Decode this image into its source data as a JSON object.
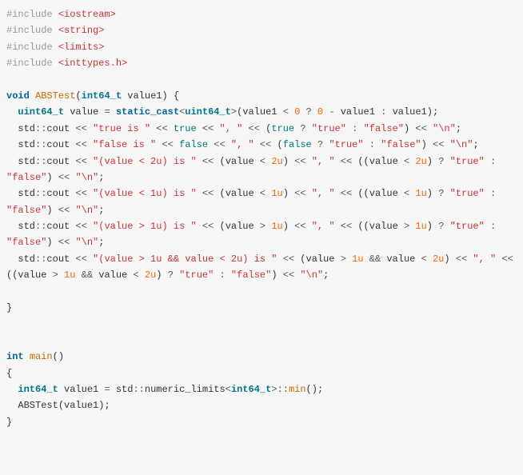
{
  "tokens": [
    {
      "cls": "pp",
      "t": "#include "
    },
    {
      "cls": "str",
      "t": "<iostream>"
    },
    {
      "cls": "",
      "t": "\n"
    },
    {
      "cls": "pp",
      "t": "#include "
    },
    {
      "cls": "str",
      "t": "<string>"
    },
    {
      "cls": "",
      "t": "\n"
    },
    {
      "cls": "pp",
      "t": "#include "
    },
    {
      "cls": "str",
      "t": "<limits>"
    },
    {
      "cls": "",
      "t": "\n"
    },
    {
      "cls": "pp",
      "t": "#include "
    },
    {
      "cls": "str",
      "t": "<inttypes.h>"
    },
    {
      "cls": "",
      "t": "\n"
    },
    {
      "cls": "",
      "t": "\n"
    },
    {
      "cls": "typ",
      "t": "void"
    },
    {
      "cls": "",
      "t": " "
    },
    {
      "cls": "fn",
      "t": "ABSTest"
    },
    {
      "cls": "pn",
      "t": "("
    },
    {
      "cls": "utyp",
      "t": "int64_t"
    },
    {
      "cls": "",
      "t": " "
    },
    {
      "cls": "id",
      "t": "value1"
    },
    {
      "cls": "pn",
      "t": ")"
    },
    {
      "cls": "",
      "t": " "
    },
    {
      "cls": "pn",
      "t": "{"
    },
    {
      "cls": "",
      "t": "\n"
    },
    {
      "cls": "",
      "t": "  "
    },
    {
      "cls": "utyp",
      "t": "uint64_t"
    },
    {
      "cls": "",
      "t": " "
    },
    {
      "cls": "id",
      "t": "value"
    },
    {
      "cls": "",
      "t": " "
    },
    {
      "cls": "op",
      "t": "="
    },
    {
      "cls": "",
      "t": " "
    },
    {
      "cls": "kw",
      "t": "static_cast"
    },
    {
      "cls": "op",
      "t": "<"
    },
    {
      "cls": "utyp",
      "t": "uint64_t"
    },
    {
      "cls": "op",
      "t": ">"
    },
    {
      "cls": "pn",
      "t": "("
    },
    {
      "cls": "id",
      "t": "value1"
    },
    {
      "cls": "",
      "t": " "
    },
    {
      "cls": "op",
      "t": "<"
    },
    {
      "cls": "",
      "t": " "
    },
    {
      "cls": "num",
      "t": "0"
    },
    {
      "cls": "",
      "t": " "
    },
    {
      "cls": "op",
      "t": "?"
    },
    {
      "cls": "",
      "t": " "
    },
    {
      "cls": "num",
      "t": "0"
    },
    {
      "cls": "",
      "t": " "
    },
    {
      "cls": "op",
      "t": "-"
    },
    {
      "cls": "",
      "t": " "
    },
    {
      "cls": "id",
      "t": "value1"
    },
    {
      "cls": "",
      "t": " "
    },
    {
      "cls": "op",
      "t": ":"
    },
    {
      "cls": "",
      "t": " "
    },
    {
      "cls": "id",
      "t": "value1"
    },
    {
      "cls": "pn",
      "t": ")"
    },
    {
      "cls": "pn",
      "t": ";"
    },
    {
      "cls": "",
      "t": "\n"
    },
    {
      "cls": "",
      "t": "  "
    },
    {
      "cls": "id",
      "t": "std"
    },
    {
      "cls": "op",
      "t": "::"
    },
    {
      "cls": "id",
      "t": "cout"
    },
    {
      "cls": "",
      "t": " "
    },
    {
      "cls": "op",
      "t": "<<"
    },
    {
      "cls": "",
      "t": " "
    },
    {
      "cls": "str",
      "t": "\"true is \""
    },
    {
      "cls": "",
      "t": " "
    },
    {
      "cls": "op",
      "t": "<<"
    },
    {
      "cls": "",
      "t": " "
    },
    {
      "cls": "bool",
      "t": "true"
    },
    {
      "cls": "",
      "t": " "
    },
    {
      "cls": "op",
      "t": "<<"
    },
    {
      "cls": "",
      "t": " "
    },
    {
      "cls": "str",
      "t": "\", \""
    },
    {
      "cls": "",
      "t": " "
    },
    {
      "cls": "op",
      "t": "<<"
    },
    {
      "cls": "",
      "t": " "
    },
    {
      "cls": "pn",
      "t": "("
    },
    {
      "cls": "bool",
      "t": "true"
    },
    {
      "cls": "",
      "t": " "
    },
    {
      "cls": "op",
      "t": "?"
    },
    {
      "cls": "",
      "t": " "
    },
    {
      "cls": "str",
      "t": "\"true\""
    },
    {
      "cls": "",
      "t": " "
    },
    {
      "cls": "op",
      "t": ":"
    },
    {
      "cls": "",
      "t": " "
    },
    {
      "cls": "str",
      "t": "\"false\""
    },
    {
      "cls": "pn",
      "t": ")"
    },
    {
      "cls": "",
      "t": " "
    },
    {
      "cls": "op",
      "t": "<<"
    },
    {
      "cls": "",
      "t": " "
    },
    {
      "cls": "str",
      "t": "\"\\n\""
    },
    {
      "cls": "pn",
      "t": ";"
    },
    {
      "cls": "",
      "t": "\n"
    },
    {
      "cls": "",
      "t": "  "
    },
    {
      "cls": "id",
      "t": "std"
    },
    {
      "cls": "op",
      "t": "::"
    },
    {
      "cls": "id",
      "t": "cout"
    },
    {
      "cls": "",
      "t": " "
    },
    {
      "cls": "op",
      "t": "<<"
    },
    {
      "cls": "",
      "t": " "
    },
    {
      "cls": "str",
      "t": "\"false is \""
    },
    {
      "cls": "",
      "t": " "
    },
    {
      "cls": "op",
      "t": "<<"
    },
    {
      "cls": "",
      "t": " "
    },
    {
      "cls": "bool",
      "t": "false"
    },
    {
      "cls": "",
      "t": " "
    },
    {
      "cls": "op",
      "t": "<<"
    },
    {
      "cls": "",
      "t": " "
    },
    {
      "cls": "str",
      "t": "\", \""
    },
    {
      "cls": "",
      "t": " "
    },
    {
      "cls": "op",
      "t": "<<"
    },
    {
      "cls": "",
      "t": " "
    },
    {
      "cls": "pn",
      "t": "("
    },
    {
      "cls": "bool",
      "t": "false"
    },
    {
      "cls": "",
      "t": " "
    },
    {
      "cls": "op",
      "t": "?"
    },
    {
      "cls": "",
      "t": " "
    },
    {
      "cls": "str",
      "t": "\"true\""
    },
    {
      "cls": "",
      "t": " "
    },
    {
      "cls": "op",
      "t": ":"
    },
    {
      "cls": "",
      "t": " "
    },
    {
      "cls": "str",
      "t": "\"false\""
    },
    {
      "cls": "pn",
      "t": ")"
    },
    {
      "cls": "",
      "t": " "
    },
    {
      "cls": "op",
      "t": "<<"
    },
    {
      "cls": "",
      "t": " "
    },
    {
      "cls": "str",
      "t": "\"\\n\""
    },
    {
      "cls": "pn",
      "t": ";"
    },
    {
      "cls": "",
      "t": "\n"
    },
    {
      "cls": "",
      "t": "  "
    },
    {
      "cls": "id",
      "t": "std"
    },
    {
      "cls": "op",
      "t": "::"
    },
    {
      "cls": "id",
      "t": "cout"
    },
    {
      "cls": "",
      "t": " "
    },
    {
      "cls": "op",
      "t": "<<"
    },
    {
      "cls": "",
      "t": " "
    },
    {
      "cls": "str",
      "t": "\"(value < 2u) is \""
    },
    {
      "cls": "",
      "t": " "
    },
    {
      "cls": "op",
      "t": "<<"
    },
    {
      "cls": "",
      "t": " "
    },
    {
      "cls": "pn",
      "t": "("
    },
    {
      "cls": "id",
      "t": "value"
    },
    {
      "cls": "",
      "t": " "
    },
    {
      "cls": "op",
      "t": "<"
    },
    {
      "cls": "",
      "t": " "
    },
    {
      "cls": "num",
      "t": "2u"
    },
    {
      "cls": "pn",
      "t": ")"
    },
    {
      "cls": "",
      "t": " "
    },
    {
      "cls": "op",
      "t": "<<"
    },
    {
      "cls": "",
      "t": " "
    },
    {
      "cls": "str",
      "t": "\", \""
    },
    {
      "cls": "",
      "t": " "
    },
    {
      "cls": "op",
      "t": "<<"
    },
    {
      "cls": "",
      "t": " "
    },
    {
      "cls": "pn",
      "t": "(("
    },
    {
      "cls": "id",
      "t": "value"
    },
    {
      "cls": "",
      "t": " "
    },
    {
      "cls": "op",
      "t": "<"
    },
    {
      "cls": "",
      "t": " "
    },
    {
      "cls": "num",
      "t": "2u"
    },
    {
      "cls": "pn",
      "t": ")"
    },
    {
      "cls": "",
      "t": " "
    },
    {
      "cls": "op",
      "t": "?"
    },
    {
      "cls": "",
      "t": " "
    },
    {
      "cls": "str",
      "t": "\"true\""
    },
    {
      "cls": "",
      "t": " "
    },
    {
      "cls": "op",
      "t": ":"
    },
    {
      "cls": "",
      "t": " "
    },
    {
      "cls": "str",
      "t": "\"false\""
    },
    {
      "cls": "pn",
      "t": ")"
    },
    {
      "cls": "",
      "t": " "
    },
    {
      "cls": "op",
      "t": "<<"
    },
    {
      "cls": "",
      "t": " "
    },
    {
      "cls": "str",
      "t": "\"\\n\""
    },
    {
      "cls": "pn",
      "t": ";"
    },
    {
      "cls": "",
      "t": "\n"
    },
    {
      "cls": "",
      "t": "  "
    },
    {
      "cls": "id",
      "t": "std"
    },
    {
      "cls": "op",
      "t": "::"
    },
    {
      "cls": "id",
      "t": "cout"
    },
    {
      "cls": "",
      "t": " "
    },
    {
      "cls": "op",
      "t": "<<"
    },
    {
      "cls": "",
      "t": " "
    },
    {
      "cls": "str",
      "t": "\"(value < 1u) is \""
    },
    {
      "cls": "",
      "t": " "
    },
    {
      "cls": "op",
      "t": "<<"
    },
    {
      "cls": "",
      "t": " "
    },
    {
      "cls": "pn",
      "t": "("
    },
    {
      "cls": "id",
      "t": "value"
    },
    {
      "cls": "",
      "t": " "
    },
    {
      "cls": "op",
      "t": "<"
    },
    {
      "cls": "",
      "t": " "
    },
    {
      "cls": "num",
      "t": "1u"
    },
    {
      "cls": "pn",
      "t": ")"
    },
    {
      "cls": "",
      "t": " "
    },
    {
      "cls": "op",
      "t": "<<"
    },
    {
      "cls": "",
      "t": " "
    },
    {
      "cls": "str",
      "t": "\", \""
    },
    {
      "cls": "",
      "t": " "
    },
    {
      "cls": "op",
      "t": "<<"
    },
    {
      "cls": "",
      "t": " "
    },
    {
      "cls": "pn",
      "t": "(("
    },
    {
      "cls": "id",
      "t": "value"
    },
    {
      "cls": "",
      "t": " "
    },
    {
      "cls": "op",
      "t": "<"
    },
    {
      "cls": "",
      "t": " "
    },
    {
      "cls": "num",
      "t": "1u"
    },
    {
      "cls": "pn",
      "t": ")"
    },
    {
      "cls": "",
      "t": " "
    },
    {
      "cls": "op",
      "t": "?"
    },
    {
      "cls": "",
      "t": " "
    },
    {
      "cls": "str",
      "t": "\"true\""
    },
    {
      "cls": "",
      "t": " "
    },
    {
      "cls": "op",
      "t": ":"
    },
    {
      "cls": "",
      "t": " "
    },
    {
      "cls": "str",
      "t": "\"false\""
    },
    {
      "cls": "pn",
      "t": ")"
    },
    {
      "cls": "",
      "t": " "
    },
    {
      "cls": "op",
      "t": "<<"
    },
    {
      "cls": "",
      "t": " "
    },
    {
      "cls": "str",
      "t": "\"\\n\""
    },
    {
      "cls": "pn",
      "t": ";"
    },
    {
      "cls": "",
      "t": "\n"
    },
    {
      "cls": "",
      "t": "  "
    },
    {
      "cls": "id",
      "t": "std"
    },
    {
      "cls": "op",
      "t": "::"
    },
    {
      "cls": "id",
      "t": "cout"
    },
    {
      "cls": "",
      "t": " "
    },
    {
      "cls": "op",
      "t": "<<"
    },
    {
      "cls": "",
      "t": " "
    },
    {
      "cls": "str",
      "t": "\"(value > 1u) is \""
    },
    {
      "cls": "",
      "t": " "
    },
    {
      "cls": "op",
      "t": "<<"
    },
    {
      "cls": "",
      "t": " "
    },
    {
      "cls": "pn",
      "t": "("
    },
    {
      "cls": "id",
      "t": "value"
    },
    {
      "cls": "",
      "t": " "
    },
    {
      "cls": "op",
      "t": ">"
    },
    {
      "cls": "",
      "t": " "
    },
    {
      "cls": "num",
      "t": "1u"
    },
    {
      "cls": "pn",
      "t": ")"
    },
    {
      "cls": "",
      "t": " "
    },
    {
      "cls": "op",
      "t": "<<"
    },
    {
      "cls": "",
      "t": " "
    },
    {
      "cls": "str",
      "t": "\", \""
    },
    {
      "cls": "",
      "t": " "
    },
    {
      "cls": "op",
      "t": "<<"
    },
    {
      "cls": "",
      "t": " "
    },
    {
      "cls": "pn",
      "t": "(("
    },
    {
      "cls": "id",
      "t": "value"
    },
    {
      "cls": "",
      "t": " "
    },
    {
      "cls": "op",
      "t": ">"
    },
    {
      "cls": "",
      "t": " "
    },
    {
      "cls": "num",
      "t": "1u"
    },
    {
      "cls": "pn",
      "t": ")"
    },
    {
      "cls": "",
      "t": " "
    },
    {
      "cls": "op",
      "t": "?"
    },
    {
      "cls": "",
      "t": " "
    },
    {
      "cls": "str",
      "t": "\"true\""
    },
    {
      "cls": "",
      "t": " "
    },
    {
      "cls": "op",
      "t": ":"
    },
    {
      "cls": "",
      "t": " "
    },
    {
      "cls": "str",
      "t": "\"false\""
    },
    {
      "cls": "pn",
      "t": ")"
    },
    {
      "cls": "",
      "t": " "
    },
    {
      "cls": "op",
      "t": "<<"
    },
    {
      "cls": "",
      "t": " "
    },
    {
      "cls": "str",
      "t": "\"\\n\""
    },
    {
      "cls": "pn",
      "t": ";"
    },
    {
      "cls": "",
      "t": "\n"
    },
    {
      "cls": "",
      "t": "  "
    },
    {
      "cls": "id",
      "t": "std"
    },
    {
      "cls": "op",
      "t": "::"
    },
    {
      "cls": "id",
      "t": "cout"
    },
    {
      "cls": "",
      "t": " "
    },
    {
      "cls": "op",
      "t": "<<"
    },
    {
      "cls": "",
      "t": " "
    },
    {
      "cls": "str",
      "t": "\"(value > 1u && value < 2u) is \""
    },
    {
      "cls": "",
      "t": " "
    },
    {
      "cls": "op",
      "t": "<<"
    },
    {
      "cls": "",
      "t": " "
    },
    {
      "cls": "pn",
      "t": "("
    },
    {
      "cls": "id",
      "t": "value"
    },
    {
      "cls": "",
      "t": " "
    },
    {
      "cls": "op",
      "t": ">"
    },
    {
      "cls": "",
      "t": " "
    },
    {
      "cls": "num",
      "t": "1u"
    },
    {
      "cls": "",
      "t": " "
    },
    {
      "cls": "op",
      "t": "&&"
    },
    {
      "cls": "",
      "t": " "
    },
    {
      "cls": "id",
      "t": "value"
    },
    {
      "cls": "",
      "t": " "
    },
    {
      "cls": "op",
      "t": "<"
    },
    {
      "cls": "",
      "t": " "
    },
    {
      "cls": "num",
      "t": "2u"
    },
    {
      "cls": "pn",
      "t": ")"
    },
    {
      "cls": "",
      "t": " "
    },
    {
      "cls": "op",
      "t": "<<"
    },
    {
      "cls": "",
      "t": " "
    },
    {
      "cls": "str",
      "t": "\", \""
    },
    {
      "cls": "",
      "t": " "
    },
    {
      "cls": "op",
      "t": "<<"
    },
    {
      "cls": "",
      "t": " "
    },
    {
      "cls": "pn",
      "t": "(("
    },
    {
      "cls": "id",
      "t": "value"
    },
    {
      "cls": "",
      "t": " "
    },
    {
      "cls": "op",
      "t": ">"
    },
    {
      "cls": "",
      "t": " "
    },
    {
      "cls": "num",
      "t": "1u"
    },
    {
      "cls": "",
      "t": " "
    },
    {
      "cls": "op",
      "t": "&&"
    },
    {
      "cls": "",
      "t": " "
    },
    {
      "cls": "id",
      "t": "value"
    },
    {
      "cls": "",
      "t": " "
    },
    {
      "cls": "op",
      "t": "<"
    },
    {
      "cls": "",
      "t": " "
    },
    {
      "cls": "num",
      "t": "2u"
    },
    {
      "cls": "pn",
      "t": ")"
    },
    {
      "cls": "",
      "t": " "
    },
    {
      "cls": "op",
      "t": "?"
    },
    {
      "cls": "",
      "t": " "
    },
    {
      "cls": "str",
      "t": "\"true\""
    },
    {
      "cls": "",
      "t": " "
    },
    {
      "cls": "op",
      "t": ":"
    },
    {
      "cls": "",
      "t": " "
    },
    {
      "cls": "str",
      "t": "\"false\""
    },
    {
      "cls": "pn",
      "t": ")"
    },
    {
      "cls": "",
      "t": " "
    },
    {
      "cls": "op",
      "t": "<<"
    },
    {
      "cls": "",
      "t": " "
    },
    {
      "cls": "str",
      "t": "\"\\n\""
    },
    {
      "cls": "pn",
      "t": ";"
    },
    {
      "cls": "",
      "t": "\n"
    },
    {
      "cls": "",
      "t": "\n"
    },
    {
      "cls": "pn",
      "t": "}"
    },
    {
      "cls": "",
      "t": "\n"
    },
    {
      "cls": "",
      "t": "\n"
    },
    {
      "cls": "",
      "t": "\n"
    },
    {
      "cls": "typ",
      "t": "int"
    },
    {
      "cls": "",
      "t": " "
    },
    {
      "cls": "fn",
      "t": "main"
    },
    {
      "cls": "pn",
      "t": "()"
    },
    {
      "cls": "",
      "t": "\n"
    },
    {
      "cls": "pn",
      "t": "{"
    },
    {
      "cls": "",
      "t": "\n"
    },
    {
      "cls": "",
      "t": "  "
    },
    {
      "cls": "utyp",
      "t": "int64_t"
    },
    {
      "cls": "",
      "t": " "
    },
    {
      "cls": "id",
      "t": "value1"
    },
    {
      "cls": "",
      "t": " "
    },
    {
      "cls": "op",
      "t": "="
    },
    {
      "cls": "",
      "t": " "
    },
    {
      "cls": "id",
      "t": "std"
    },
    {
      "cls": "op",
      "t": "::"
    },
    {
      "cls": "id",
      "t": "numeric_limits"
    },
    {
      "cls": "op",
      "t": "<"
    },
    {
      "cls": "utyp",
      "t": "int64_t"
    },
    {
      "cls": "op",
      "t": ">"
    },
    {
      "cls": "op",
      "t": "::"
    },
    {
      "cls": "fn",
      "t": "min"
    },
    {
      "cls": "pn",
      "t": "()"
    },
    {
      "cls": "pn",
      "t": ";"
    },
    {
      "cls": "",
      "t": "\n"
    },
    {
      "cls": "",
      "t": "  "
    },
    {
      "cls": "id",
      "t": "ABSTest"
    },
    {
      "cls": "pn",
      "t": "("
    },
    {
      "cls": "id",
      "t": "value1"
    },
    {
      "cls": "pn",
      "t": ")"
    },
    {
      "cls": "pn",
      "t": ";"
    },
    {
      "cls": "",
      "t": "\n"
    },
    {
      "cls": "pn",
      "t": "}"
    }
  ]
}
